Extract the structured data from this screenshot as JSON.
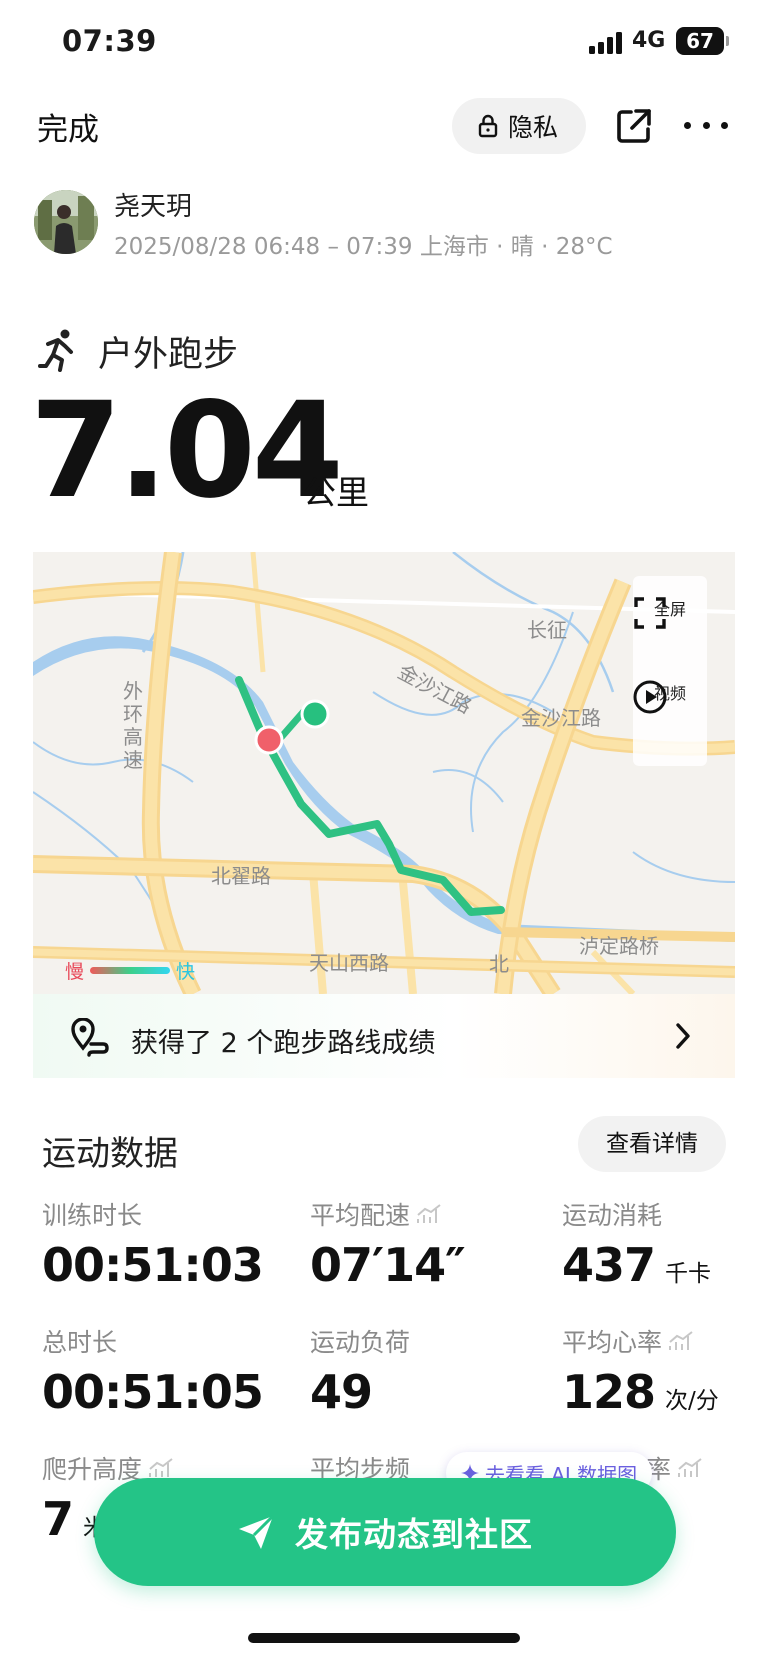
{
  "status_bar": {
    "time": "07:39",
    "network": "4G",
    "battery": "67"
  },
  "header": {
    "done_label": "完成",
    "privacy_label": "隐私"
  },
  "user": {
    "name": "尧天玥",
    "meta": "2025/08/28 06:48 – 07:39 上海市 · 晴 · 28°C"
  },
  "workout": {
    "type": "户外跑步",
    "distance": "7.04",
    "distance_unit": "公里"
  },
  "map": {
    "labels": {
      "changzheng": "长征",
      "jinshajiang_road_1": "金沙江路",
      "jinshajiang_road_2": "金沙江路",
      "outer_ring": "外环高速",
      "beizhai_road": "北翟路",
      "tianshan_west_road": "天山西路",
      "bei": "北",
      "luding_bridge": "泸定路桥"
    },
    "fullscreen_label": "全屏",
    "video_label": "视频",
    "legend_slow": "慢",
    "legend_fast": "快"
  },
  "achievement": {
    "text": "获得了 2 个跑步路线成绩"
  },
  "stats": {
    "title": "运动数据",
    "details_label": "查看详情",
    "items": [
      {
        "label": "训练时长",
        "value": "00:51:03",
        "unit": ""
      },
      {
        "label": "平均配速",
        "value": "07′14″",
        "unit": ""
      },
      {
        "label": "运动消耗",
        "value": "437",
        "unit": "千卡"
      },
      {
        "label": "总时长",
        "value": "00:51:05",
        "unit": ""
      },
      {
        "label": "运动负荷",
        "value": "49",
        "unit": ""
      },
      {
        "label": "平均心率",
        "value": "128",
        "unit": "次/分"
      },
      {
        "label": "爬升高度",
        "value": "7",
        "unit": "米"
      },
      {
        "label": "平均步频",
        "value": "",
        "unit": ""
      },
      {
        "label": "率",
        "value": "",
        "unit": ""
      }
    ]
  },
  "ai_chip": {
    "label": "去看看 AI 数据图"
  },
  "publish": {
    "label": "发布动态到社区"
  },
  "colors": {
    "accent": "#24c487",
    "route": "#2fc183",
    "start": "#f0606a",
    "end": "#27c07f"
  }
}
